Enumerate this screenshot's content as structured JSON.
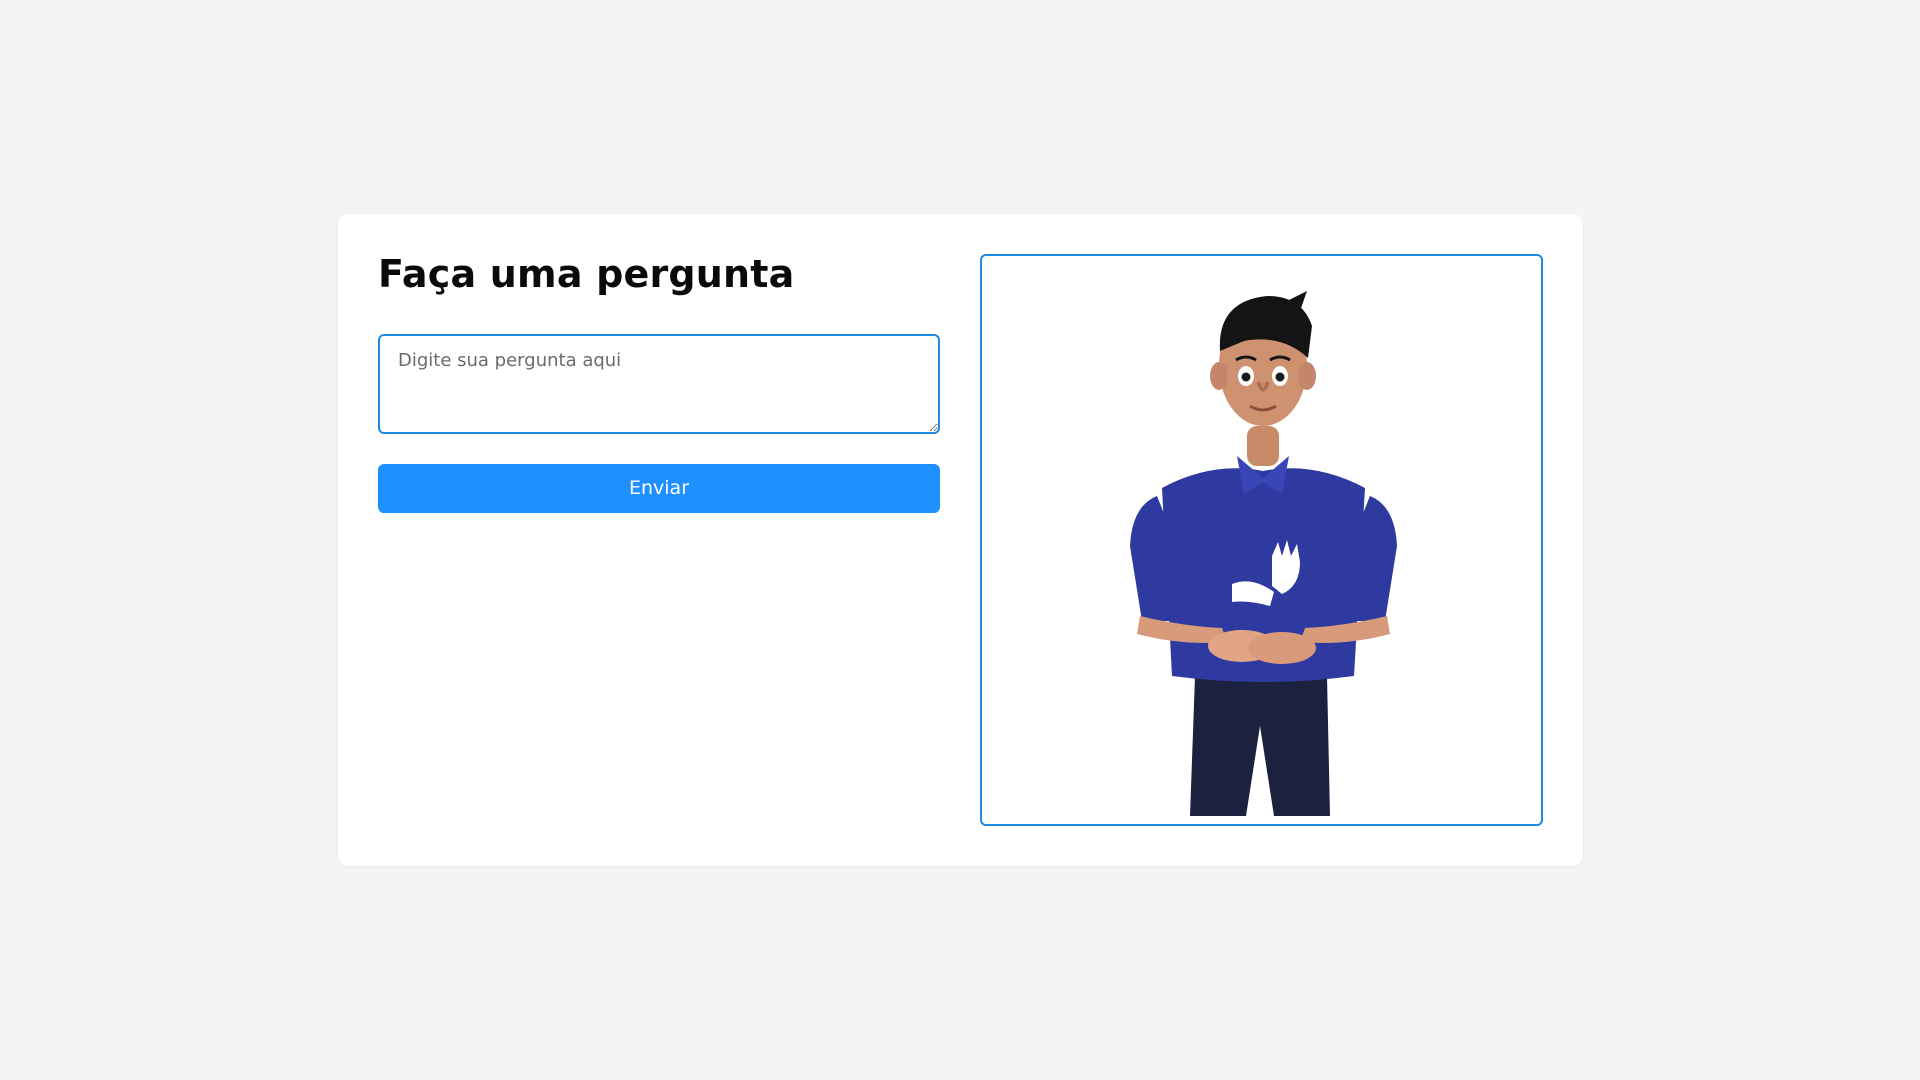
{
  "form": {
    "title": "Faça uma pergunta",
    "question_placeholder": "Digite sua pergunta aqui",
    "question_value": "",
    "submit_label": "Enviar"
  },
  "avatar": {
    "description_icon": "sign-language-avatar",
    "shirt_logo_icon": "sign-language-hands-icon"
  },
  "colors": {
    "accent": "#1e90ff",
    "border": "#1f8ae6",
    "background": "#f3f4f6",
    "card": "#ffffff",
    "shirt": "#2f3aa0"
  }
}
